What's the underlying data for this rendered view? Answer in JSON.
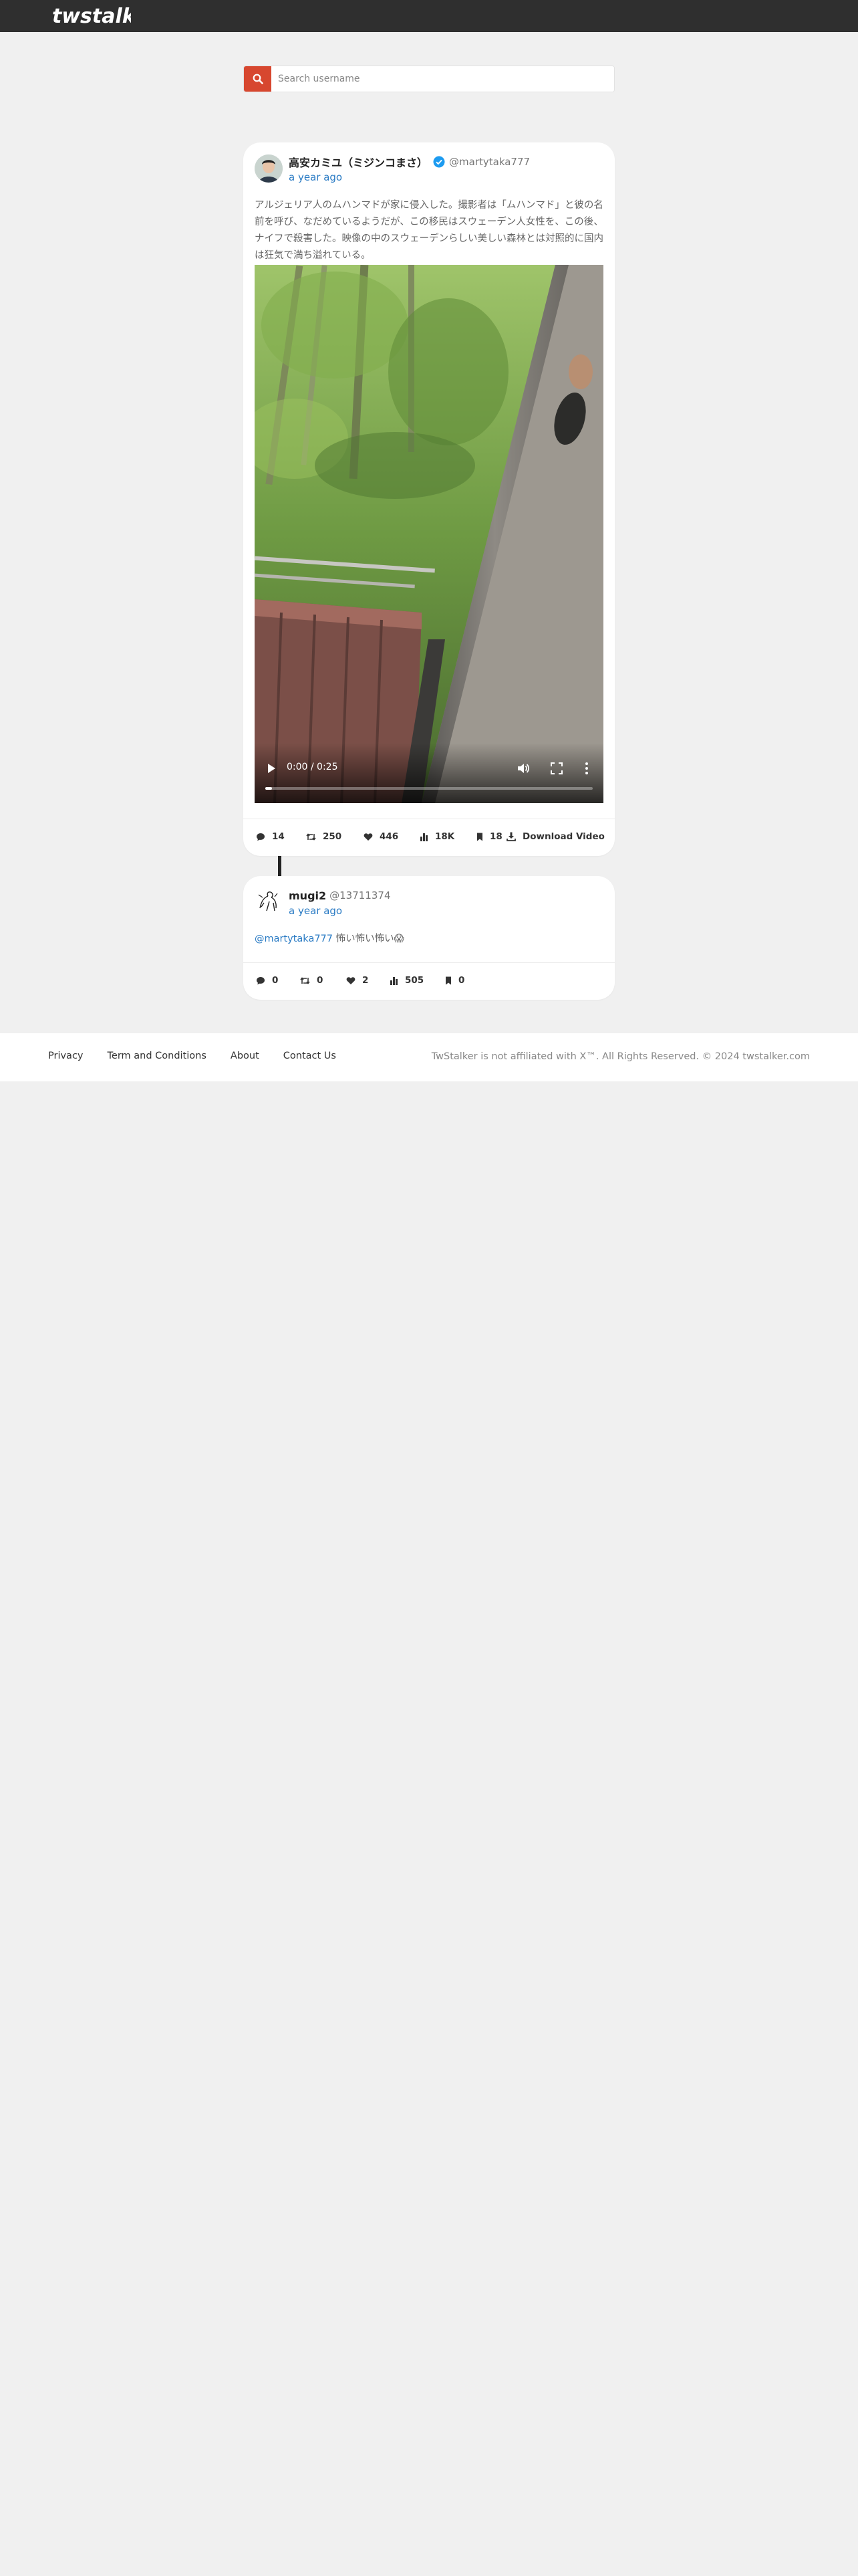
{
  "header": {
    "brand": "twstalker"
  },
  "search": {
    "placeholder": "Search username"
  },
  "tweets": [
    {
      "display_name": "高安カミユ（ミジンコまさ）",
      "handle": "@martytaka777",
      "verified": true,
      "time": "a year ago",
      "text": "アルジェリア人のムハンマドが家に侵入した。撮影者は「ムハンマド」と彼の名前を呼び、なだめているようだが、この移民はスウェーデン人女性を、この後、ナイフで殺害した。映像の中のスウェーデンらしい美しい森林とは対照的に国内は狂気で満ち溢れている。",
      "video": {
        "time": "0:00 / 0:25",
        "progress": 0.02
      },
      "stats": {
        "replies": "14",
        "retweets": "250",
        "likes": "446",
        "views": "18K",
        "bookmarks": "18",
        "download_label": "Download Video"
      }
    },
    {
      "display_name": "mugi2",
      "handle": "@13711374",
      "verified": false,
      "time": "a year ago",
      "mention": "@martytaka777",
      "text": " 怖い怖い怖い😱",
      "stats": {
        "replies": "0",
        "retweets": "0",
        "likes": "2",
        "views": "505",
        "bookmarks": "0"
      }
    }
  ],
  "footer": {
    "links": [
      "Privacy",
      "Term and Conditions",
      "About",
      "Contact Us"
    ],
    "copyright": "TwStalker is not affiliated with X™. All Rights Reserved. © 2024 twstalker.com"
  },
  "colors": {
    "accent": "#d7472f",
    "link": "#2a7bc4",
    "topbar": "#2f2f2f",
    "background": "#f0f0f0",
    "verified": "#1d9bf0"
  }
}
